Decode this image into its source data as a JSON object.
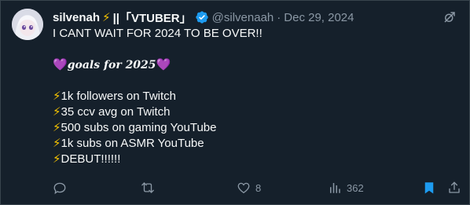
{
  "tweet": {
    "display_name": "silvenah",
    "name_suffix": "||「VTUBER」",
    "handle": "@silvenaah",
    "separator": "·",
    "date": "Dec 29, 2024",
    "body_line1": "I CANT WAIT FOR 2024 TO BE OVER!!",
    "goals_prefix": "💜",
    "goals_label": "goals for 2025",
    "goals_suffix": "💜",
    "goal_items": [
      "1k followers on Twitch",
      "35 ccv avg on Twitch",
      "500 subs on gaming YouTube",
      "1k subs on ASMR YouTube",
      "DEBUT!!!!!!"
    ],
    "bolt_glyph": "⚡"
  },
  "actions": {
    "like_count": "8",
    "view_count": "362"
  },
  "colors": {
    "background": "#15202b",
    "text": "#f7f9f9",
    "muted": "#8b98a5",
    "verified": "#1d9bf0",
    "bookmark_active": "#1d9bf0"
  },
  "icons": {
    "verified": "verified-badge-icon",
    "grok": "grok-icon",
    "reply": "reply-icon",
    "retweet": "retweet-icon",
    "like": "heart-icon",
    "views": "views-chart-icon",
    "bookmark": "bookmark-icon",
    "share": "share-icon"
  }
}
